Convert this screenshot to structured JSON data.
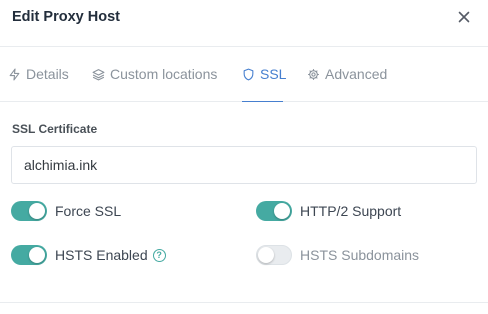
{
  "modal": {
    "title": "Edit Proxy Host",
    "close_icon": "close-icon"
  },
  "tabs": [
    {
      "label": "Details",
      "icon": "bolt-icon",
      "active": false
    },
    {
      "label": "Custom locations",
      "icon": "layers-icon",
      "active": false
    },
    {
      "label": "SSL",
      "icon": "shield-icon",
      "active": true
    },
    {
      "label": "Advanced",
      "icon": "gear-icon",
      "active": false
    }
  ],
  "ssl": {
    "certificate_label": "SSL Certificate",
    "certificate_value": "alchimia.ink",
    "options": [
      {
        "label": "Force SSL",
        "enabled": true
      },
      {
        "label": "HTTP/2 Support",
        "enabled": true
      },
      {
        "label": "HSTS Enabled",
        "enabled": true,
        "help_icon": "question-circle-icon"
      },
      {
        "label": "HSTS Subdomains",
        "enabled": false
      }
    ]
  },
  "colors": {
    "accent": "#467fcf",
    "toggle_on": "#45aaa2",
    "muted_text": "#8b939c"
  }
}
